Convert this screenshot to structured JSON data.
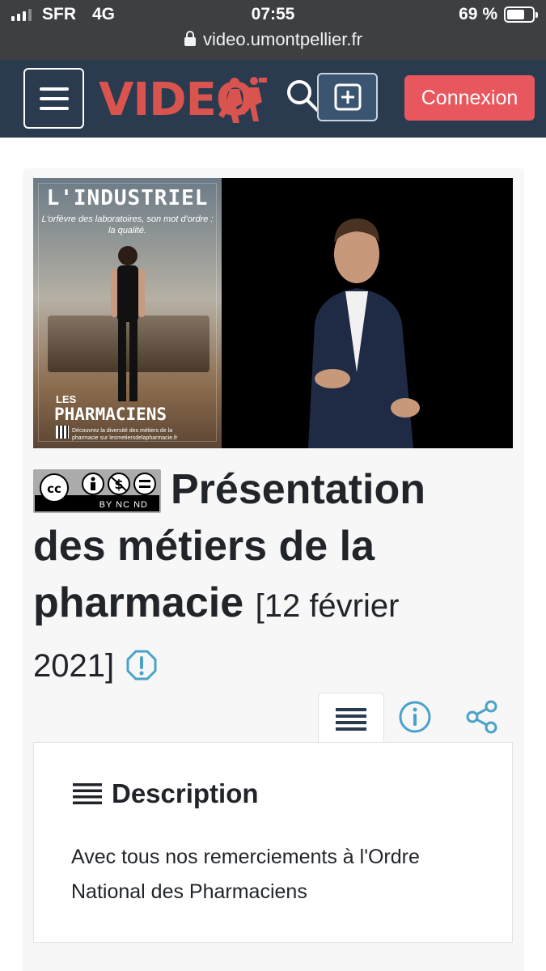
{
  "status_bar": {
    "carrier": "SFR",
    "network": "4G",
    "time": "07:55",
    "battery": "69 %",
    "battery_level": 0.69,
    "url": "video.umontpellier.fr"
  },
  "navbar": {
    "logo_text": "VIDEO",
    "login_label": "Connexion",
    "brand_color": "#2a3a4f",
    "accent_color": "#e8575e"
  },
  "video": {
    "poster_title": "L'INDUSTRIEL",
    "poster_subtitle": "L'orfèvre des laboratoires, son mot d'ordre : la qualité.",
    "poster_les": "LES",
    "poster_brand": "PHARMACIENS",
    "poster_footer": "Découvrez la diversité des métiers de la pharmacie sur lesmetiersdelapharmacie.fr"
  },
  "license": {
    "tags": "BY NC ND"
  },
  "page": {
    "title": "Présentation des métiers de la pharmacie",
    "date": "[12 février 2021]"
  },
  "description": {
    "heading": "Description",
    "text": "Avec tous nos remerciements à l'Ordre National des Pharmaciens"
  }
}
